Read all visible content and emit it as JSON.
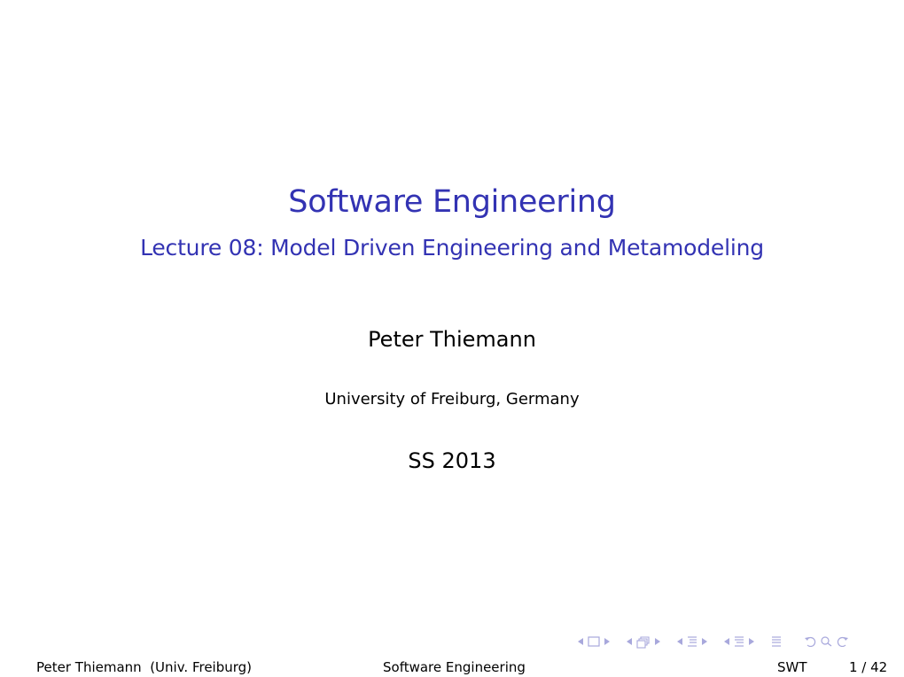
{
  "slide": {
    "title": "Software Engineering",
    "subtitle": "Lecture 08: Model Driven Engineering and Metamodeling",
    "author": "Peter Thiemann",
    "institute": "University of Freiburg, Germany",
    "date": "SS 2013"
  },
  "footer": {
    "left": "Peter Thiemann  (Univ. Freiburg)",
    "center": "Software Engineering",
    "short_title": "SWT",
    "page": "1 / 42"
  },
  "navigation": {
    "icons": [
      "arrow-left-icon",
      "frame-icon",
      "arrow-right-icon",
      "arrow-left-icon",
      "subsection-icon",
      "arrow-right-icon",
      "arrow-left-icon",
      "section-icon",
      "arrow-right-icon",
      "arrow-left-icon",
      "section-icon",
      "arrow-right-icon",
      "document-icon",
      "back-icon",
      "search-icon",
      "forward-icon"
    ]
  },
  "colors": {
    "title": "#3333b3",
    "nav": "#a8a8dc"
  }
}
